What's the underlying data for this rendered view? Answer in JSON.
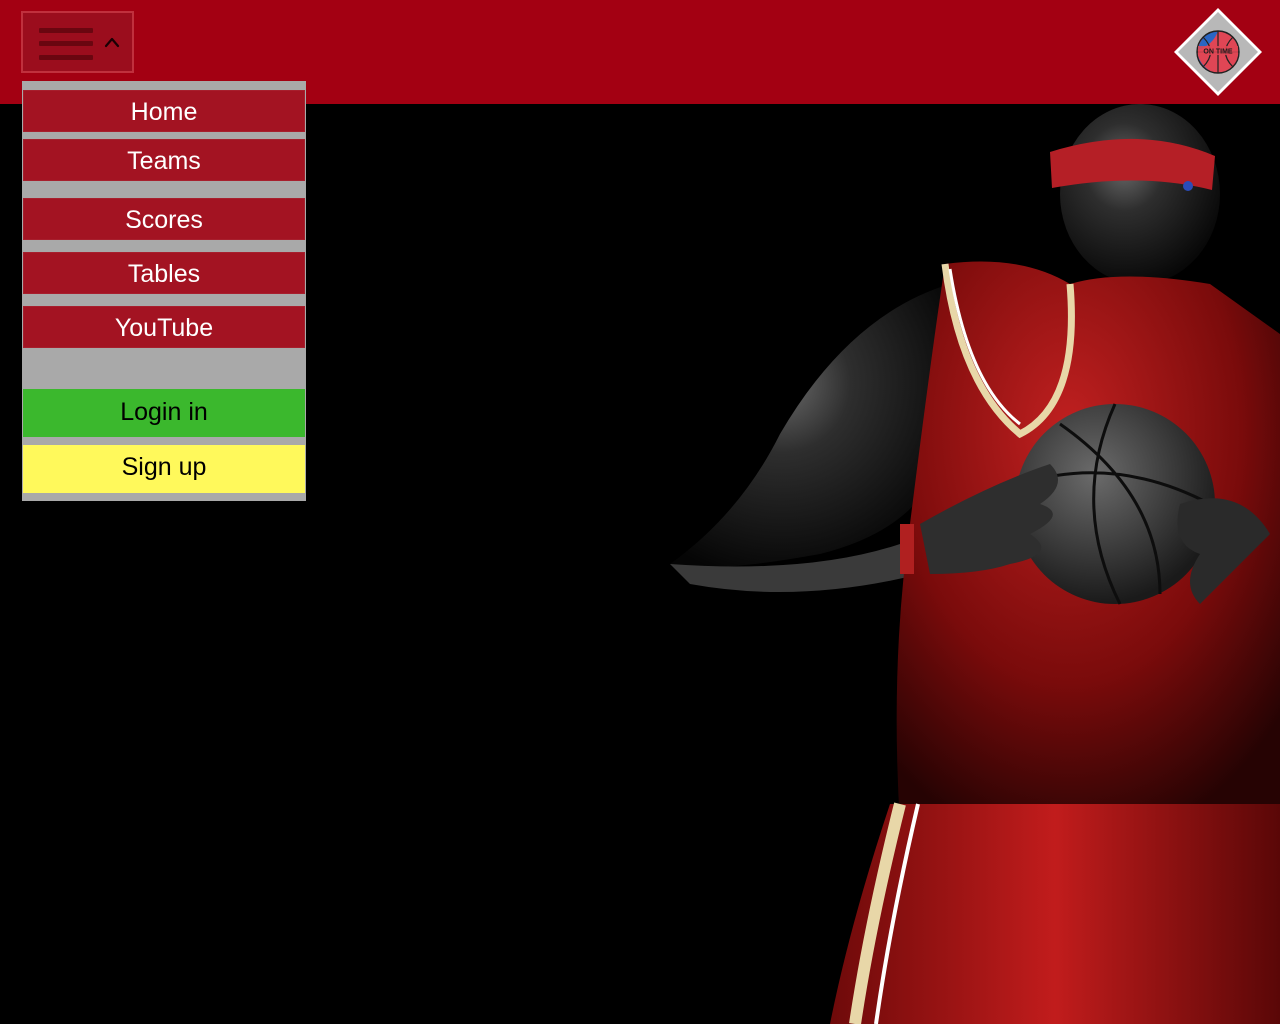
{
  "header": {
    "brand_color": "#a30012",
    "menu_toggle": {
      "icon": "hamburger-icon",
      "state_icon": "caret-up-icon"
    },
    "logo": {
      "icon": "basketball-logo-icon",
      "text": "ON TIME"
    }
  },
  "menu": {
    "items": [
      {
        "label": "Home"
      },
      {
        "label": "Teams"
      },
      {
        "label": "Scores"
      },
      {
        "label": "Tables"
      },
      {
        "label": "YouTube"
      }
    ],
    "login_label": "Login in",
    "signup_label": "Sign up",
    "colors": {
      "item": "#a31322",
      "login": "#3bb82d",
      "signup": "#fff95b",
      "separator": "#a9a9a9"
    }
  },
  "hero": {
    "image": "basketball-player-image"
  }
}
